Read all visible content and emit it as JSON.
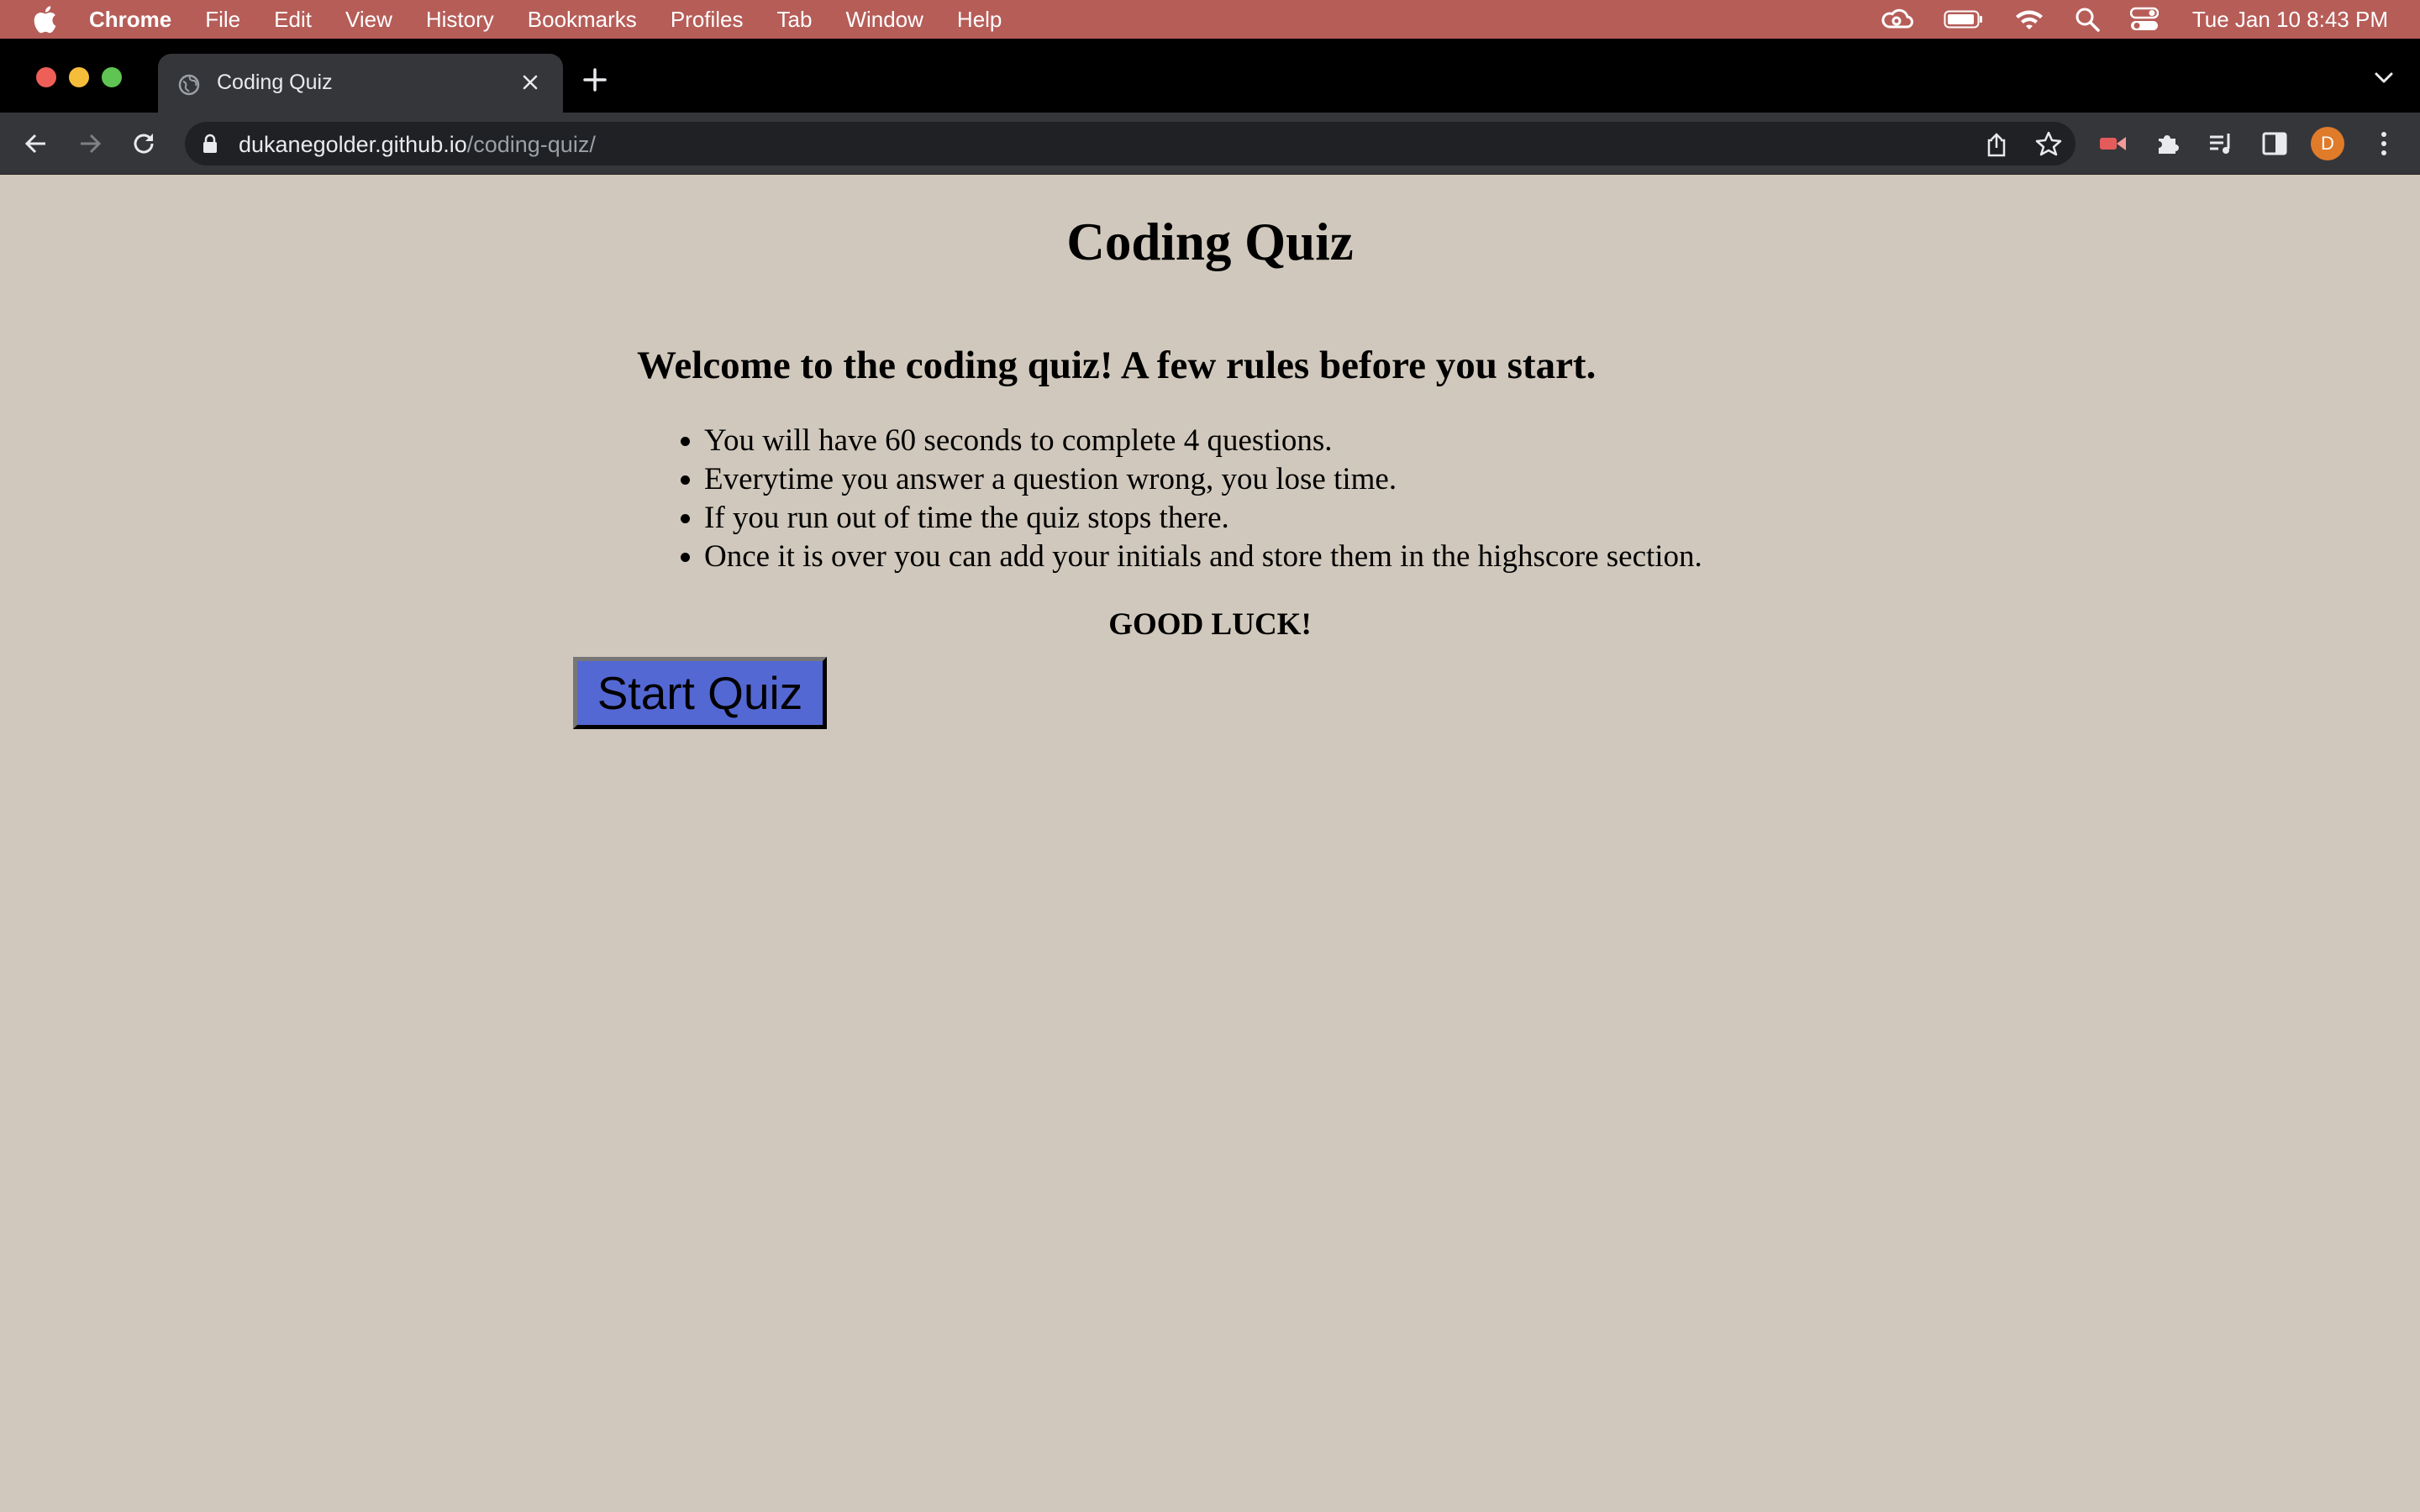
{
  "menubar": {
    "app_name": "Chrome",
    "items": [
      "File",
      "Edit",
      "View",
      "History",
      "Bookmarks",
      "Profiles",
      "Tab",
      "Window",
      "Help"
    ],
    "clock": "Tue Jan 10  8:43 PM",
    "status_icons": [
      "creative-cloud-icon",
      "battery-icon",
      "wifi-icon",
      "spotlight-search-icon",
      "control-center-icon"
    ]
  },
  "browser": {
    "tab_title": "Coding Quiz",
    "url_host": "dukanegolder.github.io",
    "url_path": "/coding-quiz/",
    "profile_initial": "D",
    "profile_color": "#e07b2a"
  },
  "page": {
    "title": "Coding Quiz",
    "welcome": "Welcome to the coding quiz! A few rules before you start.",
    "rules": [
      "You will have 60 seconds to complete 4 questions.",
      "Everytime you answer a question wrong, you lose time.",
      "If you run out of time the quiz stops there.",
      "Once it is over you can add your initials and store them in the highscore section."
    ],
    "good_luck": "GOOD LUCK!",
    "start_button": "Start Quiz",
    "button_color": "#5468d4",
    "background_color": "#d0c8bc"
  }
}
